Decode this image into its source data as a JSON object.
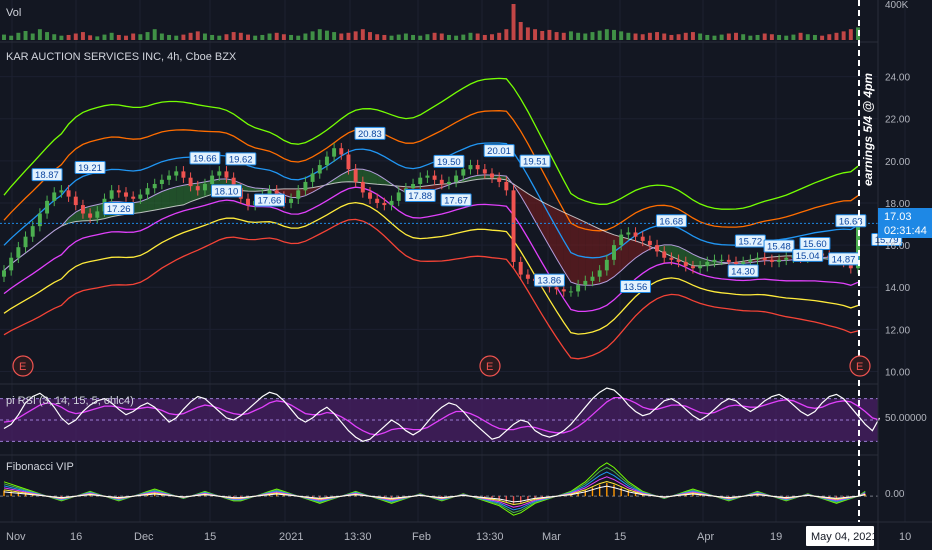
{
  "panes": {
    "volume_label": "Vol",
    "volume_tick": "400K",
    "main_title": "KAR AUCTION SERVICES INC, 4h, Cboe BZX",
    "rsi_label": "pi RSI (3, 14, 15, 5, ohlc4)",
    "rsi_tick": "50.00000",
    "fib_label": "Fibonacci VIP",
    "fib_tick": "0.00"
  },
  "annotation": "earnings 5/4 @ 4pm",
  "last_price": {
    "value": "17.03",
    "countdown": "02:31:44"
  },
  "date_cursor": "May 04, 2021",
  "earnings_marker": "E",
  "colors": {
    "background": "#131722",
    "up": "#26a69a",
    "up_bright": "#4caf50",
    "down": "#ef5350",
    "band_lime": "#76ff03",
    "band_orange": "#ff6d00",
    "band_yellow": "#ffeb3b",
    "band_red": "#f44336",
    "band_magenta": "#e040fb",
    "band_blue": "#2196f3",
    "rsi_fill": "#4a1f66",
    "label_bg": "#1e88e5"
  },
  "chart_data": {
    "type": "candlestick",
    "title": "KAR AUCTION SERVICES INC, 4h, Cboe BZX",
    "y_ticks": [
      "24.00",
      "22.00",
      "20.00",
      "18.00",
      "16.00",
      "14.00",
      "12.00",
      "10.00"
    ],
    "ylim": [
      9.5,
      25.5
    ],
    "x_ticks": [
      "Nov",
      "16",
      "Dec",
      "15",
      "2021",
      "13:30",
      "Feb",
      "13:30",
      "Mar",
      "15",
      "Apr",
      "19",
      "May 04, 2021",
      "10"
    ],
    "close": [
      14.8,
      15.4,
      15.9,
      16.4,
      16.9,
      17.5,
      18.1,
      18.5,
      18.6,
      18.3,
      17.9,
      17.5,
      17.3,
      17.6,
      18.2,
      18.6,
      18.5,
      18.3,
      18.2,
      18.4,
      18.7,
      18.9,
      19.1,
      19.3,
      19.5,
      19.2,
      18.8,
      18.6,
      18.9,
      19.3,
      19.5,
      19.2,
      18.7,
      18.2,
      17.9,
      18.1,
      18.4,
      18.6,
      18.3,
      18.0,
      18.2,
      18.6,
      19.0,
      19.4,
      19.8,
      20.2,
      20.6,
      20.3,
      19.6,
      19.0,
      18.5,
      18.2,
      18.0,
      17.9,
      18.1,
      18.5,
      18.7,
      18.9,
      19.2,
      19.3,
      19.1,
      18.9,
      19.0,
      19.3,
      19.6,
      19.8,
      19.6,
      19.4,
      19.2,
      19.0,
      18.6,
      15.2,
      14.6,
      14.4,
      14.3,
      14.2,
      14.0,
      13.9,
      13.8,
      13.8,
      14.1,
      14.3,
      14.5,
      14.8,
      15.3,
      16.0,
      16.5,
      16.6,
      16.4,
      16.2,
      16.0,
      15.7,
      15.4,
      15.3,
      15.2,
      15.0,
      14.9,
      15.0,
      15.2,
      15.3,
      15.3,
      15.2,
      15.1,
      15.2,
      15.3,
      15.4,
      15.3,
      15.2,
      15.3,
      15.4,
      15.5,
      15.4,
      15.5,
      15.6,
      15.5,
      15.4,
      15.3,
      15.2,
      14.9,
      17.03
    ],
    "rsi_range": [
      20,
      80
    ],
    "rsi": [
      42,
      46,
      55,
      66,
      72,
      75,
      70,
      62,
      52,
      46,
      50,
      58,
      64,
      68,
      70,
      66,
      60,
      55,
      58,
      63,
      66,
      62,
      55,
      48,
      52,
      60,
      67,
      72,
      70,
      64,
      58,
      52,
      50,
      54,
      60,
      66,
      72,
      76,
      74,
      68,
      60,
      52,
      48,
      52,
      58,
      62,
      56,
      48,
      40,
      34,
      30,
      32,
      38,
      44,
      50,
      46,
      40,
      36,
      40,
      48,
      56,
      62,
      66,
      64,
      58,
      50,
      44,
      38,
      32,
      34,
      40,
      46,
      50,
      48,
      40,
      36,
      34,
      36,
      40,
      46,
      54,
      62,
      70,
      76,
      80,
      78,
      72,
      64,
      58,
      54,
      56,
      62,
      68,
      70,
      66,
      60,
      54,
      50,
      54,
      60,
      66,
      70,
      68,
      62,
      58,
      62,
      68,
      72,
      74,
      70,
      64,
      58,
      54,
      58,
      66,
      72,
      74,
      70,
      62,
      54,
      46,
      40,
      52
    ],
    "rsi_signal": [
      48,
      49,
      52,
      56,
      60,
      64,
      66,
      65,
      62,
      58,
      56,
      57,
      59,
      61,
      63,
      63,
      62,
      60,
      60,
      61,
      62,
      61,
      59,
      56,
      55,
      56,
      59,
      62,
      64,
      63,
      61,
      58,
      56,
      55,
      56,
      59,
      62,
      66,
      68,
      67,
      64,
      60,
      56,
      55,
      55,
      57,
      56,
      53,
      49,
      44,
      40,
      37,
      36,
      38,
      41,
      42,
      42,
      41,
      41,
      43,
      47,
      51,
      55,
      58,
      58,
      56,
      53,
      49,
      45,
      42,
      41,
      41,
      43,
      44,
      43,
      41,
      39,
      38,
      38,
      40,
      44,
      49,
      55,
      61,
      67,
      71,
      71,
      69,
      66,
      62,
      60,
      60,
      62,
      64,
      64,
      63,
      60,
      57,
      56,
      57,
      60,
      63,
      64,
      63,
      62,
      62,
      64,
      66,
      68,
      69,
      68,
      65,
      62,
      61,
      62,
      65,
      67,
      68,
      67,
      63,
      58,
      52,
      50
    ],
    "fib_range": [
      -1,
      1.6
    ],
    "fib": [
      0.6,
      0.5,
      0.4,
      0.3,
      0.2,
      0.1,
      0.0,
      -0.1,
      -0.2,
      -0.1,
      0.0,
      0.1,
      0.2,
      0.1,
      0.0,
      -0.1,
      -0.2,
      -0.1,
      0.0,
      0.1,
      0.2,
      0.3,
      0.2,
      0.1,
      0.0,
      -0.1,
      0.0,
      0.1,
      0.2,
      0.1,
      0.0,
      -0.1,
      -0.2,
      -0.2,
      -0.1,
      0.0,
      0.1,
      0.2,
      0.3,
      0.2,
      0.1,
      0.0,
      -0.1,
      -0.2,
      -0.3,
      -0.2,
      -0.1,
      0.0,
      0.1,
      0.2,
      0.1,
      0.0,
      -0.1,
      -0.2,
      -0.3,
      -0.2,
      -0.1,
      0.0,
      0.1,
      0.0,
      -0.1,
      -0.2,
      -0.1,
      0.0,
      0.1,
      0.0,
      -0.1,
      -0.2,
      -0.3,
      -0.4,
      -0.6,
      -0.8,
      -0.7,
      -0.5,
      -0.3,
      -0.2,
      -0.1,
      0.0,
      0.1,
      0.2,
      0.4,
      0.6,
      0.9,
      1.2,
      1.4,
      1.2,
      0.9,
      0.6,
      0.4,
      0.2,
      0.1,
      0.0,
      -0.1,
      0.0,
      0.1,
      0.2,
      0.3,
      0.2,
      0.1,
      0.0,
      -0.1,
      -0.2,
      -0.1,
      0.0,
      0.1,
      0.2,
      0.1,
      0.0,
      -0.1,
      -0.2,
      -0.1,
      0.0,
      0.1,
      0.0,
      -0.1,
      -0.2,
      -0.3,
      -0.2,
      -0.1,
      0.0,
      0.2
    ],
    "volume": [
      0.15,
      0.12,
      0.2,
      0.25,
      0.18,
      0.3,
      0.22,
      0.16,
      0.12,
      0.14,
      0.18,
      0.22,
      0.13,
      0.1,
      0.15,
      0.2,
      0.14,
      0.12,
      0.18,
      0.16,
      0.22,
      0.3,
      0.18,
      0.14,
      0.12,
      0.15,
      0.2,
      0.24,
      0.18,
      0.14,
      0.12,
      0.16,
      0.22,
      0.2,
      0.15,
      0.12,
      0.14,
      0.18,
      0.2,
      0.16,
      0.14,
      0.12,
      0.18,
      0.24,
      0.3,
      0.26,
      0.22,
      0.18,
      0.2,
      0.24,
      0.3,
      0.22,
      0.16,
      0.14,
      0.12,
      0.15,
      0.18,
      0.14,
      0.12,
      0.16,
      0.2,
      0.18,
      0.14,
      0.12,
      0.15,
      0.2,
      0.18,
      0.14,
      0.16,
      0.2,
      0.3,
      1.0,
      0.5,
      0.35,
      0.3,
      0.25,
      0.28,
      0.22,
      0.2,
      0.24,
      0.2,
      0.18,
      0.22,
      0.26,
      0.3,
      0.28,
      0.24,
      0.2,
      0.18,
      0.16,
      0.2,
      0.22,
      0.18,
      0.14,
      0.16,
      0.2,
      0.22,
      0.18,
      0.14,
      0.12,
      0.15,
      0.18,
      0.2,
      0.16,
      0.12,
      0.14,
      0.18,
      0.16,
      0.14,
      0.12,
      0.15,
      0.2,
      0.16,
      0.14,
      0.12,
      0.16,
      0.2,
      0.24,
      0.3,
      0.35
    ],
    "price_labels": [
      {
        "text": "18.87",
        "i": 6
      },
      {
        "text": "19.21",
        "i": 12
      },
      {
        "text": "17.26",
        "i": 16
      },
      {
        "text": "19.66",
        "i": 28
      },
      {
        "text": "19.62",
        "i": 33
      },
      {
        "text": "18.10",
        "i": 31
      },
      {
        "text": "17.66",
        "i": 37
      },
      {
        "text": "20.83",
        "i": 51
      },
      {
        "text": "19.50",
        "i": 62
      },
      {
        "text": "17.88",
        "i": 58
      },
      {
        "text": "17.67",
        "i": 63
      },
      {
        "text": "20.01",
        "i": 69
      },
      {
        "text": "19.51",
        "i": 74
      },
      {
        "text": "13.86",
        "i": 76
      },
      {
        "text": "13.56",
        "i": 88
      },
      {
        "text": "16.68",
        "i": 93
      },
      {
        "text": "15.72",
        "i": 104
      },
      {
        "text": "15.48",
        "i": 108
      },
      {
        "text": "14.30",
        "i": 103
      },
      {
        "text": "15.60",
        "i": 113
      },
      {
        "text": "15.04",
        "i": 112
      },
      {
        "text": "16.68",
        "i": 118
      },
      {
        "text": "14.87",
        "i": 117
      },
      {
        "text": "15.79",
        "i": 123
      }
    ],
    "label_values": {
      "6": 18.87,
      "12": 19.21,
      "16": 17.26,
      "28": 19.66,
      "33": 19.62,
      "31": 18.1,
      "37": 17.66,
      "51": 20.83,
      "62": 19.5,
      "58": 17.88,
      "63": 17.67,
      "69": 20.01,
      "74": 19.51,
      "76": 13.86,
      "88": 13.56,
      "93": 16.68,
      "104": 15.72,
      "108": 15.48,
      "103": 14.3,
      "113": 15.6,
      "112": 15.04,
      "118": 16.68,
      "117": 14.87,
      "123": 15.79
    }
  }
}
